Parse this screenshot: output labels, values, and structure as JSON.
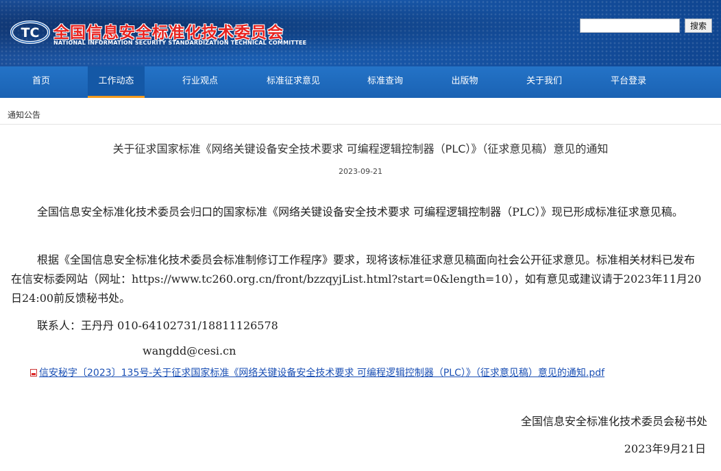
{
  "header": {
    "logo_text": "TC",
    "title": "全国信息安全标准化技术委员会",
    "subtitle": "NATIONAL INFORMATION SECURITY STANDARDIZATION TECHNICAL COMMITTEE",
    "search_placeholder": "",
    "search_button": "搜索"
  },
  "nav": {
    "items": [
      "首页",
      "工作动态",
      "行业观点",
      "标准征求意见",
      "标准查询",
      "出版物",
      "关于我们",
      "平台登录"
    ],
    "active_index": 1,
    "accent_color": "#f39a1e"
  },
  "breadcrumb": "通知公告",
  "article": {
    "title": "关于征求国家标准《网络关键设备安全技术要求 可编程逻辑控制器（PLC）》（征求意见稿）意见的通知",
    "date": "2023-09-21",
    "paragraph1": "全国信息安全标准化技术委员会归口的国家标准《网络关键设备安全技术要求 可编程逻辑控制器（PLC）》现已形成标准征求意见稿。",
    "paragraph2": "根据《全国信息安全标准化技术委员会标准制修订工作程序》要求，现将该标准征求意见稿面向社会公开征求意见。标准相关材料已发布在信安标委网站（网址：https://www.tc260.org.cn/front/bzzqyjList.html?start=0&length=10），如有意见或建议请于2023年11月20日24:00前反馈秘书处。",
    "contact": "联系人：王丹丹  010-64102731/18811126578",
    "email": "wangdd@cesi.cn",
    "attachment": "信安秘字〔2023〕135号-关于征求国家标准《网络关键设备安全技术要求 可编程逻辑控制器（PLC）》（征求意见稿）意见的通知.pdf",
    "signature": "全国信息安全标准化技术委员会秘书处",
    "sign_date": "2023年9月21日"
  }
}
